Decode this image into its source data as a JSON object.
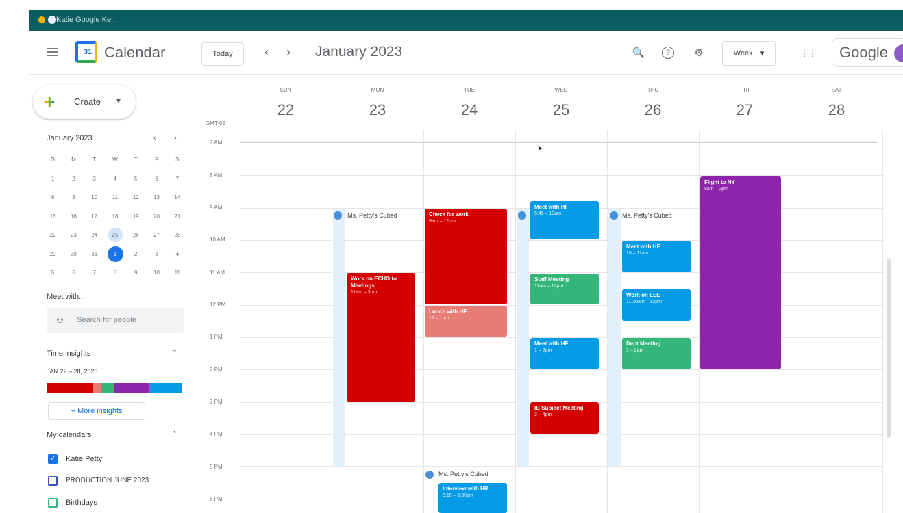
{
  "browser": {
    "tab_title": "Katie Google Ke..."
  },
  "header": {
    "app_title": "Calendar",
    "logo_day": "31",
    "today_label": "Today",
    "prev": "‹",
    "next": "›",
    "month_title": "January 2023",
    "view_label": "Week",
    "google_label": "Google"
  },
  "icons": {
    "search": "🔍",
    "help": "?",
    "settings": "⚙",
    "apps": "⋮⋮",
    "caret": "▾",
    "collapse": "⌃"
  },
  "sidebar": {
    "create_label": "Create",
    "mini_calendar": {
      "title": "January 2023",
      "nav_prev": "‹",
      "nav_next": "›",
      "weekdays": [
        "S",
        "M",
        "T",
        "W",
        "T",
        "F",
        "S"
      ],
      "weeks": [
        [
          "1",
          "2",
          "3",
          "4",
          "5",
          "6",
          "7"
        ],
        [
          "8",
          "9",
          "10",
          "11",
          "12",
          "13",
          "14"
        ],
        [
          "15",
          "16",
          "17",
          "18",
          "19",
          "20",
          "21"
        ],
        [
          "22",
          "23",
          "24",
          "25",
          "26",
          "27",
          "28"
        ],
        [
          "29",
          "30",
          "31",
          "1",
          "2",
          "3",
          "4"
        ],
        [
          "5",
          "6",
          "7",
          "8",
          "9",
          "10",
          "11"
        ]
      ]
    },
    "meet_with_label": "Meet with...",
    "search_people_placeholder": "Search for people",
    "time_insights": {
      "label": "Time insights",
      "range": "JAN 22 – 28, 2023",
      "more_label": "More insights"
    },
    "my_calendars": {
      "label": "My calendars",
      "items": [
        {
          "name": "Katie Petty",
          "checked": true
        },
        {
          "name": "PRODUCTION JUNE 2023",
          "checked": false
        },
        {
          "name": "Birthdays",
          "checked": false
        }
      ]
    }
  },
  "week": {
    "timezone": "GMT-05",
    "days": [
      {
        "name": "SUN",
        "num": "22"
      },
      {
        "name": "MON",
        "num": "23"
      },
      {
        "name": "TUE",
        "num": "24"
      },
      {
        "name": "WED",
        "num": "25"
      },
      {
        "name": "THU",
        "num": "26"
      },
      {
        "name": "FRI",
        "num": "27"
      },
      {
        "name": "SAT",
        "num": "28"
      }
    ],
    "hours": [
      "7 AM",
      "8 AM",
      "9 AM",
      "10 AM",
      "11 AM",
      "12 PM",
      "1 PM",
      "2 PM",
      "3 PM",
      "4 PM",
      "5 PM",
      "6 PM"
    ]
  },
  "ooo_labels": [
    "Ms. Petty's Cubed",
    "Ms. Petty's Cubed",
    "Ms. Petty's Cubed"
  ],
  "events": [
    {
      "title": "Work on ECHO to Meetings",
      "time": "11am – 3pm",
      "color": "#d50000"
    },
    {
      "title": "Check for work",
      "time": "9am – 12pm",
      "color": "#d50000"
    },
    {
      "title": "Lunch with HF",
      "time": "12 – 1pm",
      "color": "#e67c73"
    },
    {
      "title": "Meet with HF",
      "time": "5:45 – 10am",
      "color": "#039be5"
    },
    {
      "title": "Staff Meeting",
      "time": "11am – 12pm",
      "color": "#33b679"
    },
    {
      "title": "Meet with HF",
      "time": "1 – 2pm",
      "color": "#039be5"
    },
    {
      "title": "IB Subject Meeting",
      "time": "3 – 4pm",
      "color": "#d50000"
    },
    {
      "title": "Meet with HF",
      "time": "10 – 11am",
      "color": "#039be5"
    },
    {
      "title": "Work on LEE",
      "time": "11:30am – 12pm",
      "color": "#039be5"
    },
    {
      "title": "Dept Meeting",
      "time": "1 – 2pm",
      "color": "#33b679"
    },
    {
      "title": "Flight to NY",
      "time": "8am – 2pm",
      "color": "#8e24aa"
    },
    {
      "title": "Interview with HR",
      "time": "5:15 – 6:30pm",
      "color": "#039be5"
    }
  ],
  "insight_colors": [
    "#d50000",
    "#e67c73",
    "#33b679",
    "#8e24aa",
    "#039be5"
  ]
}
